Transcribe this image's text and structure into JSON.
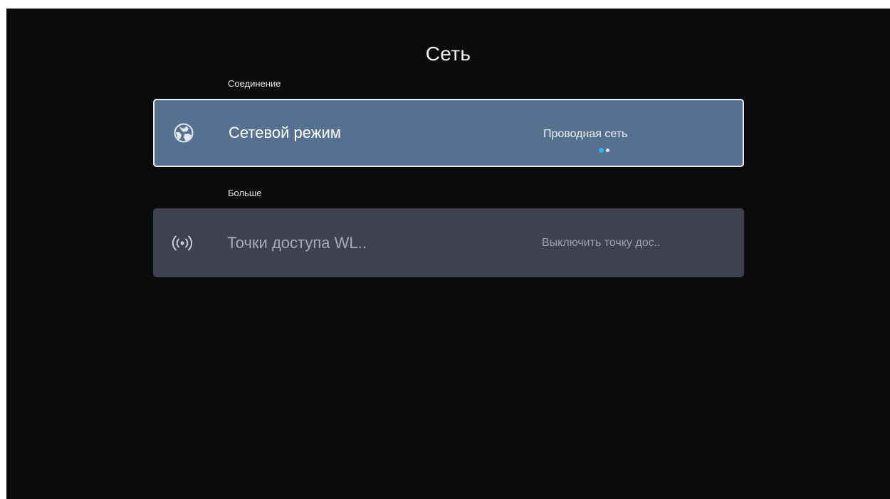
{
  "header": {
    "title": "Сеть"
  },
  "sections": {
    "connection": {
      "label": "Соединение",
      "network_mode": {
        "icon": "globe-icon",
        "label": "Сетевой режим",
        "value": "Проводная сеть",
        "options_count": 2,
        "selected_index": 0
      }
    },
    "more": {
      "label": "Больше",
      "hotspot": {
        "icon": "wifi-hotspot-icon",
        "label": "Точки доступа WL..",
        "value": "Выключить точку дос.."
      }
    }
  },
  "colors": {
    "background": "#0b0b0c",
    "focused_row": "#56718f",
    "row": "#3d4150",
    "pager_active": "#2fb6f0"
  }
}
